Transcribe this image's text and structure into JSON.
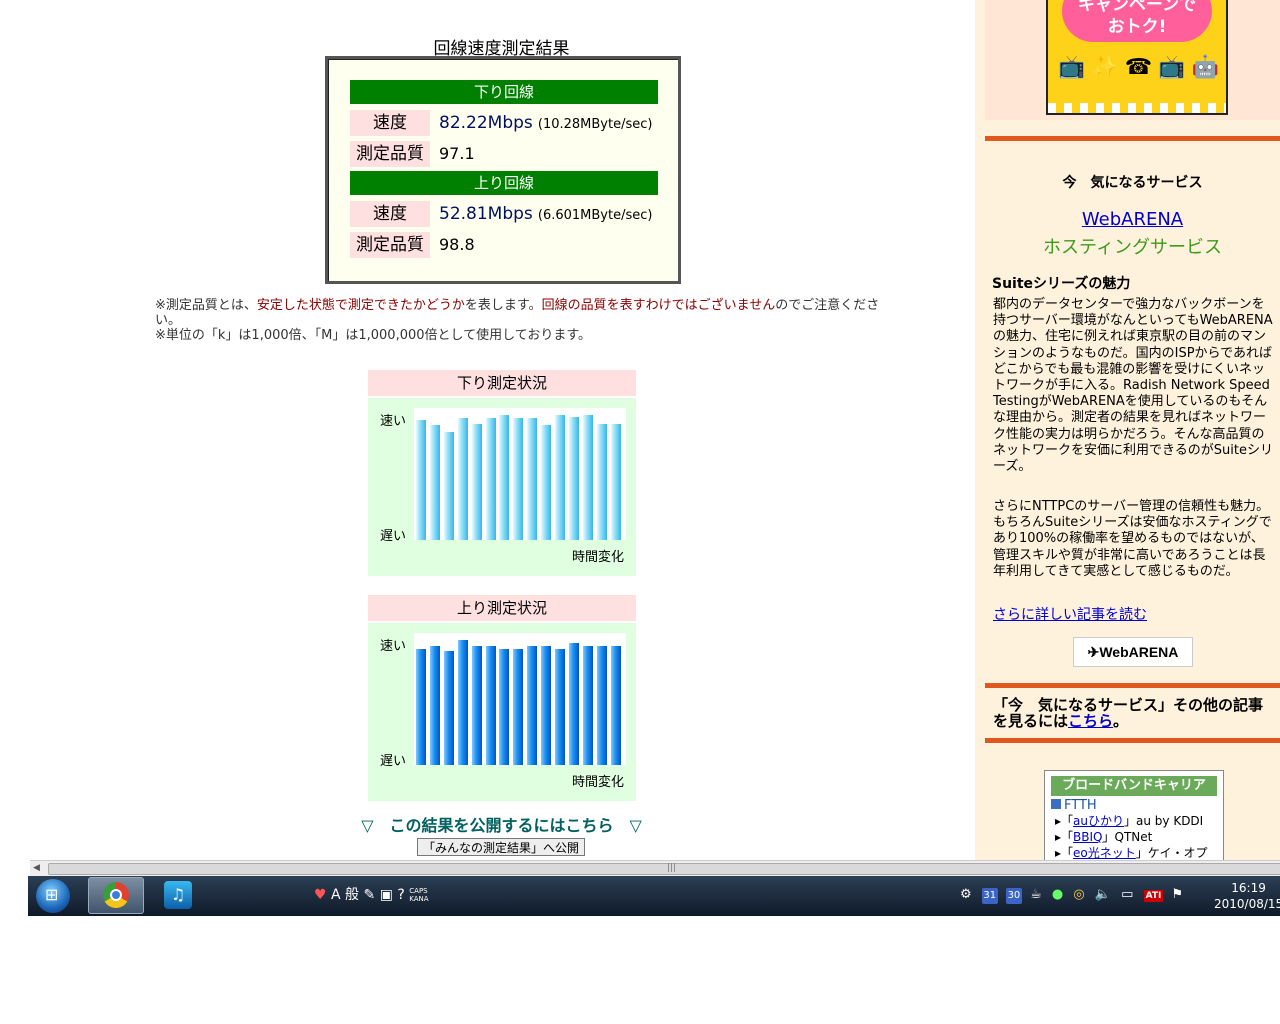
{
  "page_title": "回線速度測定結果",
  "result": {
    "download_header": "下り回線",
    "upload_header": "上り回線",
    "speed_label": "速度",
    "quality_label": "測定品質",
    "download_speed": "82.22Mbps",
    "download_speed_sub": "(10.28MByte/sec)",
    "download_quality": "97.1",
    "upload_speed": "52.81Mbps",
    "upload_speed_sub": "(6.601MByte/sec)",
    "upload_quality": "98.8"
  },
  "notes": {
    "n1_a": "※測定品質とは、",
    "n1_b": "安定した状態で測定できたかどうか",
    "n1_c": "を表します。",
    "n1_d": "回線の品質を表すわけではございません",
    "n1_e": "のでご注意ください。",
    "n2": "※単位の「k」は1,000倍、「M」は1,000,000倍として使用しております。"
  },
  "charts": {
    "download_title": "下り測定状況",
    "upload_title": "上り測定状況",
    "fast_label": "速い",
    "slow_label": "遅い",
    "time_label": "時間変化"
  },
  "chart_data": [
    {
      "type": "bar",
      "title": "下り測定状況",
      "xlabel": "時間変化",
      "ylabel": "",
      "ylim": [
        0,
        1
      ],
      "y_tick_labels": [
        "遅い",
        "速い"
      ],
      "values": [
        0.94,
        0.9,
        0.84,
        0.95,
        0.91,
        0.95,
        0.98,
        0.95,
        0.95,
        0.9,
        0.98,
        0.96,
        0.98,
        0.91,
        0.91
      ]
    },
    {
      "type": "bar",
      "title": "上り測定状況",
      "xlabel": "時間変化",
      "ylabel": "",
      "ylim": [
        0,
        1
      ],
      "y_tick_labels": [
        "遅い",
        "速い"
      ],
      "values": [
        0.91,
        0.93,
        0.89,
        0.98,
        0.93,
        0.93,
        0.91,
        0.91,
        0.93,
        0.93,
        0.91,
        0.95,
        0.93,
        0.93,
        0.93
      ]
    }
  ],
  "publish": {
    "link_text": "▽　この結果を公開するにはこちら　▽",
    "button_label": "「みんなの測定結果」へ公開"
  },
  "sidebar": {
    "campaign_text": "キャンペーンで\nおトク!",
    "service_heading": "今　気になるサービス",
    "webarena_link": "WebARENA",
    "hosting_text": "ホスティングサービス",
    "suite_heading": "Suiteシリーズの魅力",
    "para1": "都内のデータセンターで強力なバックボーンを持つサーバー環境がなんといってもWebARENAの魅力、住宅に例えれば東京駅の目の前のマンションのようなものだ。国内のISPからであればどこからでも最も混雑の影響を受けにくいネットワークが手に入る。Radish Network Speed TestingがWebARENAを使用しているのもそんな理由から。測定者の結果を見ればネットワーク性能の実力は明らかだろう。そんな高品質のネットワークを安価に利用できるのがSuiteシリーズ。",
    "para2": "さらにNTTPCのサーバー管理の信頼性も魅力。もちろんSuiteシリーズは安価なホスティングであり100%の稼働率を望めるものではないが、管理スキルや質が非常に高いであろうことは長年利用してきて実感として感じるものだ。",
    "more_link": "さらに詳しい記事を読む",
    "logo_text": "WebARENA",
    "other_text_a": "「今　気になるサービス」その他の記事を見るには",
    "other_link": "こちら",
    "other_text_b": "。",
    "carrier_header": "ブロードバンドキャリア",
    "carrier_section": "FTTH",
    "carrier_rows": [
      {
        "pre": "「",
        "link": "auひかり",
        "post": "」au by KDDI"
      },
      {
        "pre": "「",
        "link": "BBIQ",
        "post": "」QTNet"
      },
      {
        "pre": "「",
        "link": "eo光ネット",
        "post": "」ケイ・オプ"
      }
    ]
  },
  "taskbar": {
    "ime_text": "A 般",
    "caps_label": "CAPS",
    "kana_label": "KANA",
    "tray_cal1": "31",
    "tray_cal2": "30",
    "ati_label": "ATI",
    "time": "16:19",
    "date": "2010/08/15"
  }
}
